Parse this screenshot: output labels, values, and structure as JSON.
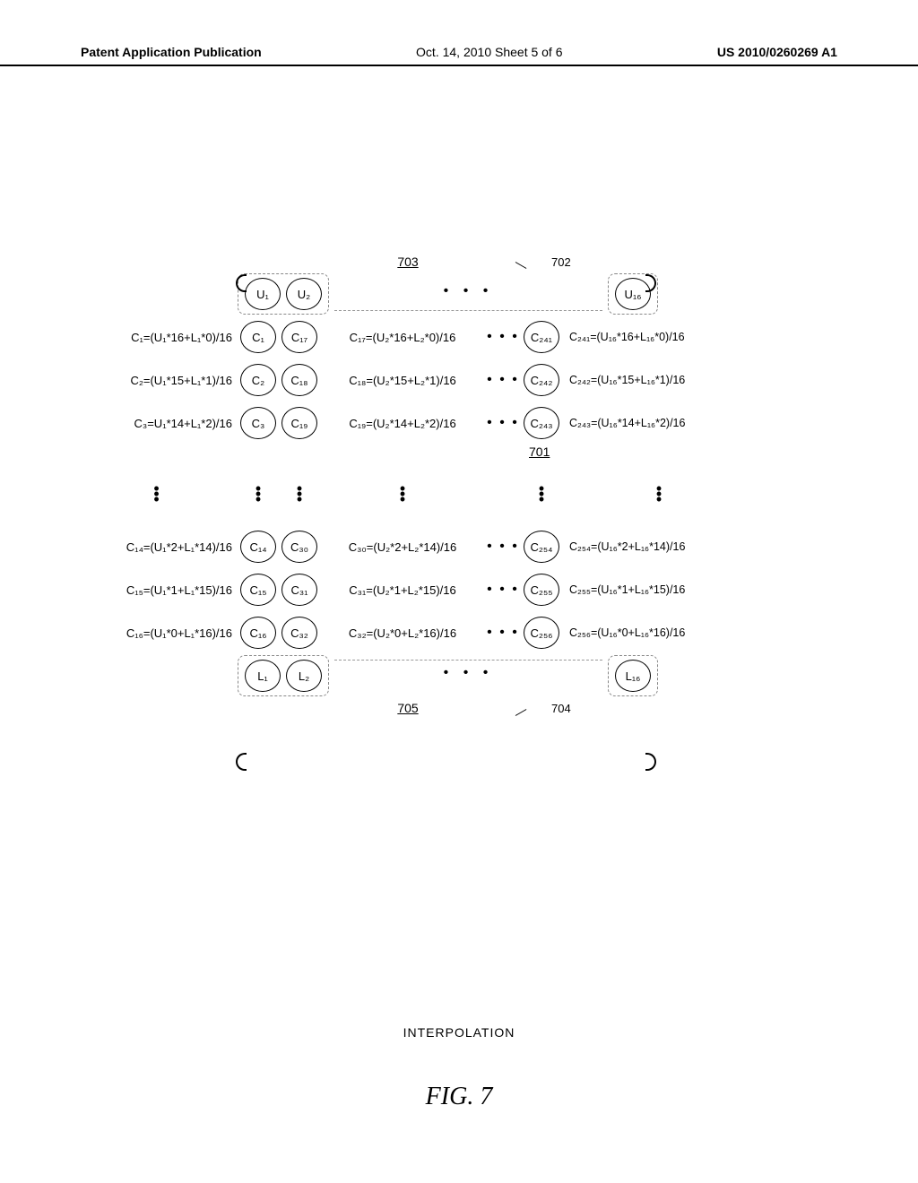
{
  "header": {
    "left": "Patent Application Publication",
    "mid": "Oct. 14, 2010  Sheet 5 of 6",
    "right": "US 2010/0260269 A1"
  },
  "refs": {
    "r703": "703",
    "r702": "702",
    "r701": "701",
    "r705": "705",
    "r704": "704"
  },
  "u": {
    "u1": "U₁",
    "u2": "U₂",
    "u16": "U₁₆"
  },
  "l": {
    "l1": "L₁",
    "l2": "L₂",
    "l16": "L₁₆"
  },
  "rows": [
    {
      "left": "C₁=(U₁*16+L₁*0)/16",
      "c_a": "C₁",
      "c_b": "C₁₇",
      "mid": "C₁₇=(U₂*16+L₂*0)/16",
      "c_c": "C₂₄₁",
      "right": "C₂₄₁=(U₁₆*16+L₁₆*0)/16"
    },
    {
      "left": "C₂=(U₁*15+L₁*1)/16",
      "c_a": "C₂",
      "c_b": "C₁₈",
      "mid": "C₁₈=(U₂*15+L₂*1)/16",
      "c_c": "C₂₄₂",
      "right": "C₂₄₂=(U₁₆*15+L₁₆*1)/16"
    },
    {
      "left": "C₃=U₁*14+L₁*2)/16",
      "c_a": "C₃",
      "c_b": "C₁₉",
      "mid": "C₁₉=(U₂*14+L₂*2)/16",
      "c_c": "C₂₄₃",
      "right": "C₂₄₃=(U₁₆*14+L₁₆*2)/16"
    },
    {
      "left": "C₁₄=(U₁*2+L₁*14)/16",
      "c_a": "C₁₄",
      "c_b": "C₃₀",
      "mid": "C₃₀=(U₂*2+L₂*14)/16",
      "c_c": "C₂₅₄",
      "right": "C₂₅₄=(U₁₆*2+L₁₆*14)/16"
    },
    {
      "left": "C₁₅=(U₁*1+L₁*15)/16",
      "c_a": "C₁₅",
      "c_b": "C₃₁",
      "mid": "C₃₁=(U₂*1+L₂*15)/16",
      "c_c": "C₂₅₅",
      "right": "C₂₅₅=(U₁₆*1+L₁₆*15)/16"
    },
    {
      "left": "C₁₆=(U₁*0+L₁*16)/16",
      "c_a": "C₁₆",
      "c_b": "C₃₂",
      "mid": "C₃₂=(U₂*0+L₂*16)/16",
      "c_c": "C₂₅₆",
      "right": "C₂₅₆=(U₁₆*0+L₁₆*16)/16"
    }
  ],
  "caption": "INTERPOLATION",
  "figure": "FIG. 7",
  "dots": "• • •",
  "vdot": "⋮"
}
